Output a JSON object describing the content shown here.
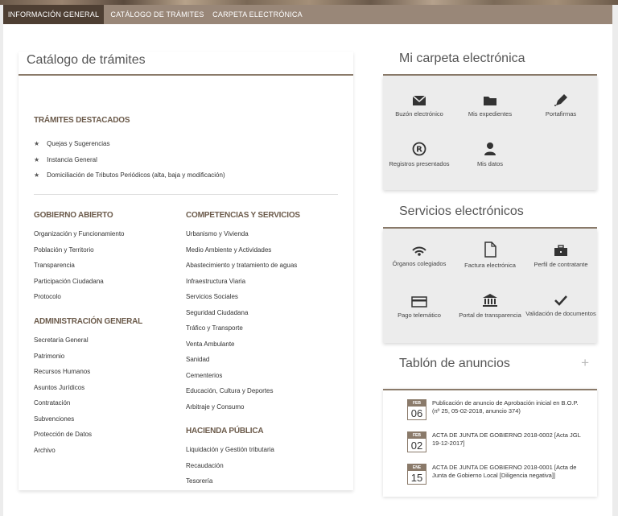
{
  "nav": {
    "tabs": [
      {
        "label": "Información General",
        "active": true
      },
      {
        "label": "Catálogo de trámites",
        "active": false
      },
      {
        "label": "Carpeta electrónica",
        "active": false
      }
    ]
  },
  "catalogo": {
    "title": "Catálogo de trámites",
    "destacados": {
      "heading": "TRÁMITES DESTACADOS",
      "items": [
        "Quejas y Sugerencias",
        "Instancia General",
        "Domiciliación de Tributos Periódicos (alta, baja y modificación)"
      ]
    },
    "gobierno_abierto": {
      "heading": "GOBIERNO ABIERTO",
      "items": [
        "Organización y Funcionamiento",
        "Población y Territorio",
        "Transparencia",
        "Participación Ciudadana",
        "Protocolo"
      ]
    },
    "administracion_general": {
      "heading": "ADMINISTRACIÓN GENERAL",
      "items": [
        "Secretaría General",
        "Patrimonio",
        "Recursos Humanos",
        "Asuntos Jurídicos",
        "Contratación",
        "Subvenciones",
        "Protección de Datos",
        "Archivo"
      ]
    },
    "competencias": {
      "heading": "COMPETENCIAS Y SERVICIOS",
      "items": [
        "Urbanismo y Vivienda",
        "Medio Ambiente y Actividades",
        "Abastecimiento y tratamiento de aguas",
        "Infraestructura Viaria",
        "Servicios Sociales",
        "Seguridad Ciudadana",
        "Tráfico y Transporte",
        "Venta Ambulante",
        "Sanidad",
        "Cementerios",
        "Educación, Cultura y Deportes",
        "Arbitraje y Consumo"
      ]
    },
    "hacienda": {
      "heading": "HACIENDA PÚBLICA",
      "items": [
        "Liquidación y Gestión tributaria",
        "Recaudación",
        "Tesorería"
      ]
    }
  },
  "carpeta": {
    "title": "Mi carpeta electrónica",
    "tiles": [
      {
        "label": "Buzón electrónico",
        "icon": "envelope-icon"
      },
      {
        "label": "Mis expedientes",
        "icon": "folder-icon"
      },
      {
        "label": "Portafirmas",
        "icon": "pen-icon"
      },
      {
        "label": "Registros presentados",
        "icon": "registered-icon"
      },
      {
        "label": "Mis datos",
        "icon": "user-icon"
      }
    ]
  },
  "servicios": {
    "title": "Servicios electrónicos",
    "tiles": [
      {
        "label": "Órganos colegiados",
        "icon": "signal-icon"
      },
      {
        "label": "Factura electrónica",
        "icon": "document-icon"
      },
      {
        "label": "Perfil de contratante",
        "icon": "briefcase-icon"
      },
      {
        "label": "Pago telemático",
        "icon": "card-icon"
      },
      {
        "label": "Portal de transparencia",
        "icon": "institution-icon"
      },
      {
        "label": "Validación de documentos",
        "icon": "check-icon"
      }
    ]
  },
  "tablon": {
    "title": "Tablón de anuncios",
    "plus": "+",
    "items": [
      {
        "month": "FEB",
        "day": "06",
        "text": "Publicación de anuncio de Aprobación inicial en B.O.P. (nº 25, 05-02-2018, anuncio 374)"
      },
      {
        "month": "FEB",
        "day": "02",
        "text": "ACTA DE JUNTA DE GOBIERNO 2018-0002 [Acta JGL 19-12-2017]"
      },
      {
        "month": "ENE",
        "day": "15",
        "text": "ACTA DE JUNTA DE GOBIERNO 2018-0001 [Acta de Junta de Gobierno Local [Diligencia negativa]]"
      }
    ]
  },
  "colors": {
    "accent": "#8a7a6a",
    "nav": "#998778",
    "nav_active": "#4e3f33",
    "heading": "#6b5a4a"
  }
}
